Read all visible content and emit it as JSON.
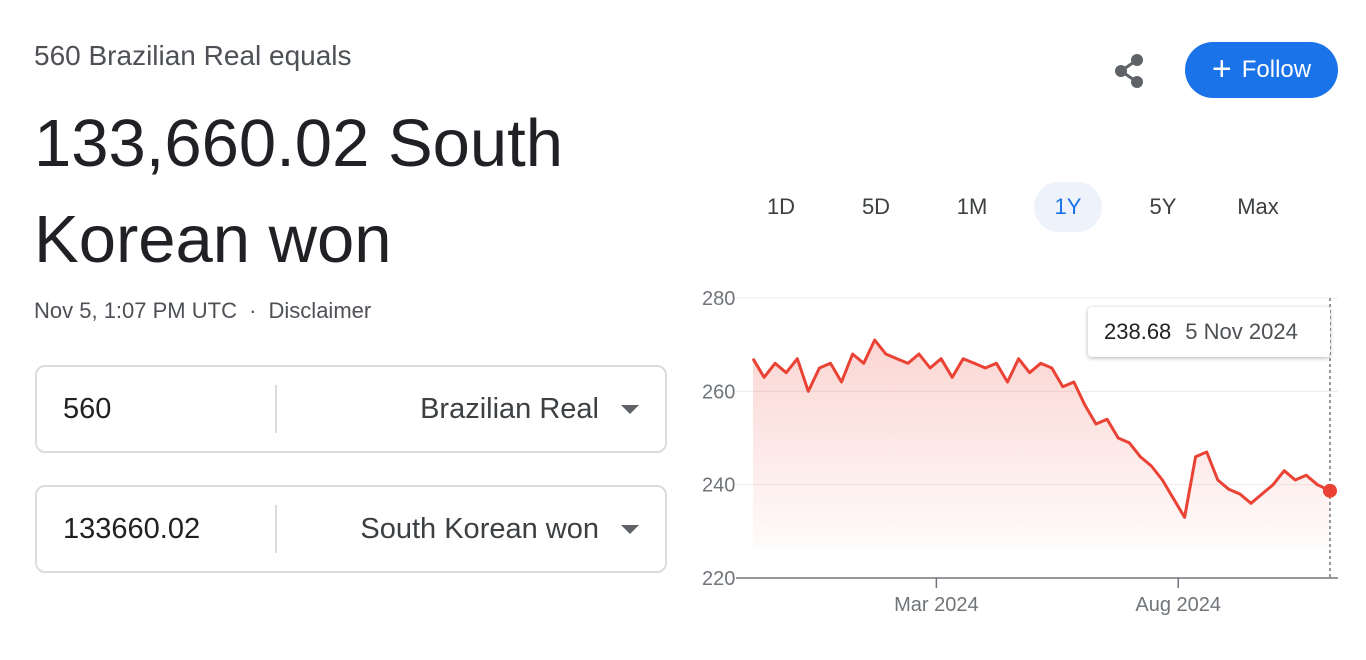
{
  "header": {
    "subtitle": "560 Brazilian Real equals",
    "result": "133,660.02 South Korean won",
    "timestamp": "Nov 5, 1:07 PM UTC",
    "separator": "·",
    "disclaimer": "Disclaimer"
  },
  "actions": {
    "share_icon": "share-icon",
    "follow_label": "Follow",
    "follow_icon": "+"
  },
  "converter": {
    "from": {
      "amount": "560",
      "currency": "Brazilian Real"
    },
    "to": {
      "amount": "133660.02",
      "currency": "South Korean won"
    }
  },
  "ranges": [
    "1D",
    "5D",
    "1M",
    "1Y",
    "5Y",
    "Max"
  ],
  "active_range": "1Y",
  "tooltip": {
    "value": "238.68",
    "date": "5 Nov 2024"
  },
  "colors": {
    "accent": "#1a73e8",
    "line": "#ea4335"
  },
  "chart_data": {
    "type": "line",
    "y_ticks": [
      "280",
      "260",
      "240",
      "220"
    ],
    "x_ticks": [
      "Mar 2024",
      "Aug 2024"
    ],
    "ylim": [
      220,
      280
    ],
    "x": [
      "2023-11-06",
      "2023-11-13",
      "2023-11-20",
      "2023-11-27",
      "2023-12-04",
      "2023-12-11",
      "2023-12-18",
      "2023-12-25",
      "2024-01-01",
      "2024-01-08",
      "2024-01-15",
      "2024-01-22",
      "2024-01-29",
      "2024-02-05",
      "2024-02-12",
      "2024-02-19",
      "2024-02-26",
      "2024-03-04",
      "2024-03-11",
      "2024-03-18",
      "2024-03-25",
      "2024-04-01",
      "2024-04-08",
      "2024-04-15",
      "2024-04-22",
      "2024-04-29",
      "2024-05-06",
      "2024-05-13",
      "2024-05-20",
      "2024-05-27",
      "2024-06-03",
      "2024-06-10",
      "2024-06-17",
      "2024-06-24",
      "2024-07-01",
      "2024-07-08",
      "2024-07-15",
      "2024-07-22",
      "2024-07-29",
      "2024-08-05",
      "2024-08-12",
      "2024-08-19",
      "2024-08-26",
      "2024-09-02",
      "2024-09-09",
      "2024-09-16",
      "2024-09-23",
      "2024-09-30",
      "2024-10-07",
      "2024-10-14",
      "2024-10-21",
      "2024-10-28",
      "2024-11-05"
    ],
    "values": [
      267,
      263,
      266,
      264,
      267,
      260,
      265,
      266,
      262,
      268,
      266,
      271,
      268,
      267,
      266,
      268,
      265,
      267,
      263,
      267,
      266,
      265,
      266,
      262,
      267,
      264,
      266,
      265,
      261,
      262,
      257,
      253,
      254,
      250,
      249,
      246,
      244,
      241,
      237,
      233,
      246,
      247,
      241,
      239,
      238,
      236,
      238,
      240,
      243,
      241,
      242,
      240,
      238.68
    ],
    "series_color": "#ea4335"
  }
}
